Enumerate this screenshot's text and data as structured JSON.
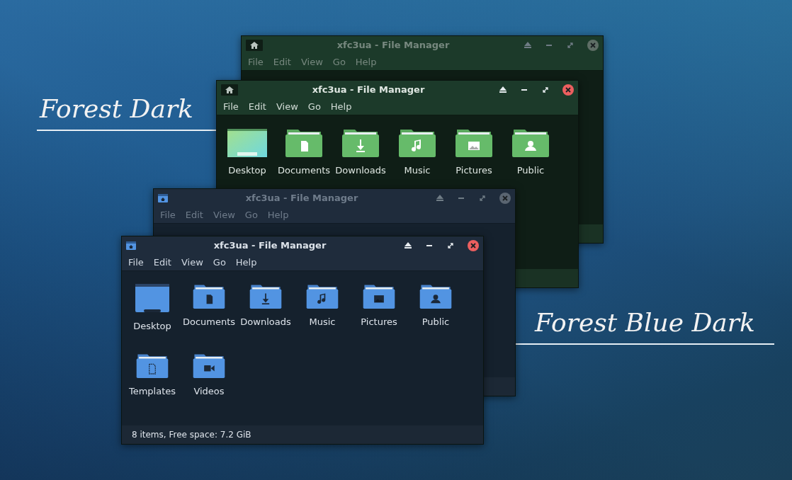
{
  "captions": [
    {
      "text": "Forest Dark"
    },
    {
      "text": "Forest Blue Dark"
    }
  ],
  "windows": [
    {
      "kind": "forest",
      "active": false,
      "title": "xfc3ua - File Manager",
      "menu": [
        "File",
        "Edit",
        "View",
        "Go",
        "Help"
      ]
    },
    {
      "kind": "forest",
      "active": true,
      "title": "xfc3ua - File Manager",
      "menu": [
        "File",
        "Edit",
        "View",
        "Go",
        "Help"
      ],
      "items": [
        {
          "kind": "desktop",
          "label": "Desktop"
        },
        {
          "kind": "documents",
          "label": "Documents"
        },
        {
          "kind": "downloads",
          "label": "Downloads"
        },
        {
          "kind": "music",
          "label": "Music"
        },
        {
          "kind": "pictures",
          "label": "Pictures"
        },
        {
          "kind": "public",
          "label": "Public"
        }
      ]
    },
    {
      "kind": "forest-blue",
      "active": false,
      "title": "xfc3ua - File Manager",
      "menu": [
        "File",
        "Edit",
        "View",
        "Go",
        "Help"
      ]
    },
    {
      "kind": "forest-blue",
      "active": true,
      "title": "xfc3ua - File Manager",
      "menu": [
        "File",
        "Edit",
        "View",
        "Go",
        "Help"
      ],
      "items": [
        {
          "kind": "desktop",
          "label": "Desktop"
        },
        {
          "kind": "documents",
          "label": "Documents"
        },
        {
          "kind": "downloads",
          "label": "Downloads"
        },
        {
          "kind": "music",
          "label": "Music"
        },
        {
          "kind": "pictures",
          "label": "Pictures"
        },
        {
          "kind": "public",
          "label": "Public"
        },
        {
          "kind": "templates",
          "label": "Templates"
        },
        {
          "kind": "videos",
          "label": "Videos"
        }
      ],
      "status": "8 items, Free space: 7.2 GiB"
    }
  ]
}
